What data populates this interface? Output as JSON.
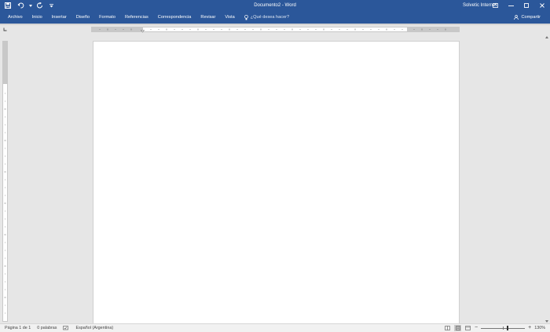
{
  "window": {
    "title": "Documento2  -  Word",
    "user": "Solvetic Internet"
  },
  "ribbon": {
    "tabs": [
      "Archivo",
      "Inicio",
      "Insertar",
      "Diseño",
      "Formato",
      "Referencias",
      "Correspondencia",
      "Revisar",
      "Vista"
    ],
    "tell_me": "¿Qué desea hacer?",
    "share": "Compartir"
  },
  "status": {
    "page": "Página 1 de 1",
    "words": "0 palabras",
    "language": "Español (Argentina)",
    "zoom": "130%"
  },
  "colors": {
    "accent": "#2b579a"
  },
  "icons": {
    "save": "save-icon",
    "undo": "undo-icon",
    "redo": "redo-icon",
    "qat_more": "chevron-down-icon",
    "tell_me": "lightbulb-icon",
    "share": "person-icon",
    "proofing": "proofing-icon"
  }
}
